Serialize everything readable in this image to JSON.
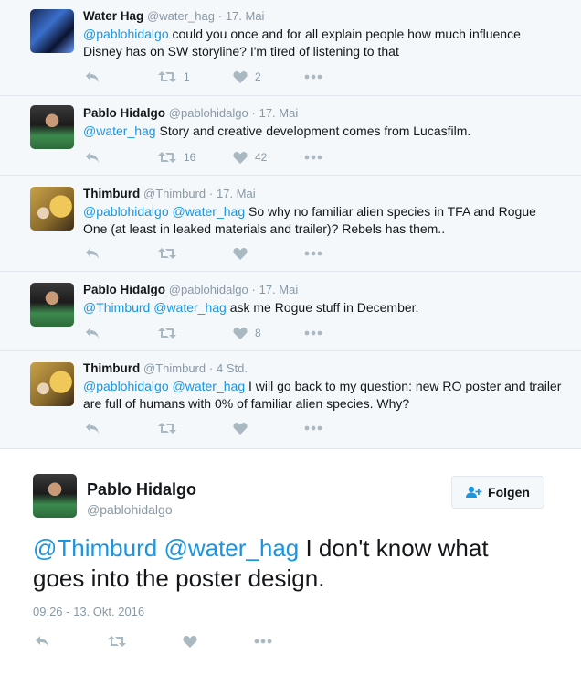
{
  "thread": [
    {
      "name": "Water Hag",
      "handle": "@water_hag",
      "time": "17. Mai",
      "avatar": "water-hag-avatar",
      "text_parts": [
        {
          "t": "@pablohidalgo",
          "mention": true
        },
        {
          "t": " could you once and for all explain people how much influence Disney has on SW storyline? I'm tired of listening to that",
          "mention": false
        }
      ],
      "retweets": "1",
      "likes": "2"
    },
    {
      "name": "Pablo Hidalgo",
      "handle": "@pablohidalgo",
      "time": "17. Mai",
      "avatar": "pablo-avatar",
      "text_parts": [
        {
          "t": "@water_hag",
          "mention": true
        },
        {
          "t": " Story and creative development comes from Lucasfilm.",
          "mention": false
        }
      ],
      "retweets": "16",
      "likes": "42"
    },
    {
      "name": "Thimburd",
      "handle": "@Thimburd",
      "time": "17. Mai",
      "avatar": "thimburd-avatar",
      "text_parts": [
        {
          "t": "@pablohidalgo",
          "mention": true
        },
        {
          "t": " ",
          "mention": false
        },
        {
          "t": "@water_hag",
          "mention": true
        },
        {
          "t": " So why no familiar alien species in TFA and Rogue One (at least in leaked materials and trailer)? Rebels has them..",
          "mention": false
        }
      ],
      "retweets": "",
      "likes": ""
    },
    {
      "name": "Pablo Hidalgo",
      "handle": "@pablohidalgo",
      "time": "17. Mai",
      "avatar": "pablo-avatar",
      "text_parts": [
        {
          "t": "@Thimburd",
          "mention": true
        },
        {
          "t": " ",
          "mention": false
        },
        {
          "t": "@water_hag",
          "mention": true
        },
        {
          "t": " ask me Rogue stuff in December.",
          "mention": false
        }
      ],
      "retweets": "",
      "likes": "8"
    },
    {
      "name": "Thimburd",
      "handle": "@Thimburd",
      "time": "4 Std.",
      "avatar": "thimburd-avatar",
      "text_parts": [
        {
          "t": "@pablohidalgo",
          "mention": true
        },
        {
          "t": " ",
          "mention": false
        },
        {
          "t": "@water_hag",
          "mention": true
        },
        {
          "t": " I will go back to my question: new RO poster and trailer are full of humans with 0% of familiar alien species. Why?",
          "mention": false
        }
      ],
      "retweets": "",
      "likes": ""
    }
  ],
  "main": {
    "name": "Pablo Hidalgo",
    "handle": "@pablohidalgo",
    "follow_label": "Folgen",
    "text_parts": [
      {
        "t": "@Thimburd",
        "mention": true
      },
      {
        "t": " ",
        "mention": false
      },
      {
        "t": "@water_hag",
        "mention": true
      },
      {
        "t": " I don't know what goes into the poster design.",
        "mention": false
      }
    ],
    "timestamp": "09:26 - 13. Okt. 2016"
  },
  "colors": {
    "mention": "#1b95e0",
    "icon": "#aab8c2",
    "muted": "#8899a6"
  },
  "icons": [
    "reply-icon",
    "retweet-icon",
    "like-icon",
    "more-icon",
    "follow-user-icon"
  ]
}
